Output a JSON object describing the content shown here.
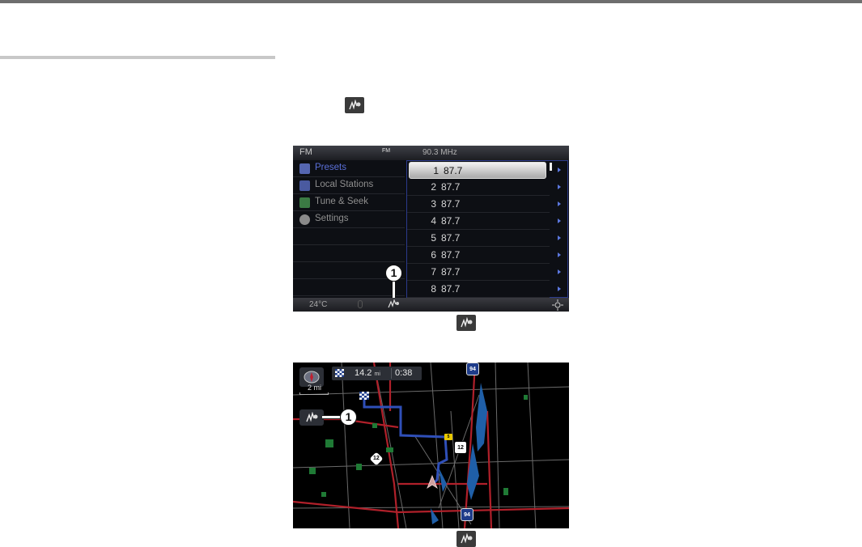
{
  "radio": {
    "band": "FM",
    "fm_badge": "FM",
    "frequency": "90.3 MHz",
    "menu": [
      {
        "label": "Presets",
        "icon": "presets-icon",
        "active": true
      },
      {
        "label": "Local Stations",
        "icon": "local-stations-icon",
        "active": false
      },
      {
        "label": "Tune & Seek",
        "icon": "tune-seek-icon",
        "active": false
      },
      {
        "label": "Settings",
        "icon": "settings-icon",
        "active": false
      }
    ],
    "presets": [
      {
        "num": "1",
        "freq": "87.7"
      },
      {
        "num": "2",
        "freq": "87.7"
      },
      {
        "num": "3",
        "freq": "87.7"
      },
      {
        "num": "4",
        "freq": "87.7"
      },
      {
        "num": "5",
        "freq": "87.7"
      },
      {
        "num": "6",
        "freq": "87.7"
      },
      {
        "num": "7",
        "freq": "87.7"
      },
      {
        "num": "8",
        "freq": "87.7"
      }
    ],
    "temperature": "24°C",
    "callout": "1"
  },
  "map": {
    "distance": "14.2",
    "distance_unit": "mi",
    "time": "0:38",
    "scale": "2 mi",
    "callout": "1",
    "shields": {
      "i94_top": "94",
      "i94_bottom": "94",
      "us12": "12",
      "state12": "12",
      "small": "5"
    }
  },
  "colors": {
    "route": "#2f4fb8",
    "major_road": "#b0202a",
    "water": "#1f5fa8",
    "park": "#1f7a35",
    "accent": "#5a6fd8"
  }
}
